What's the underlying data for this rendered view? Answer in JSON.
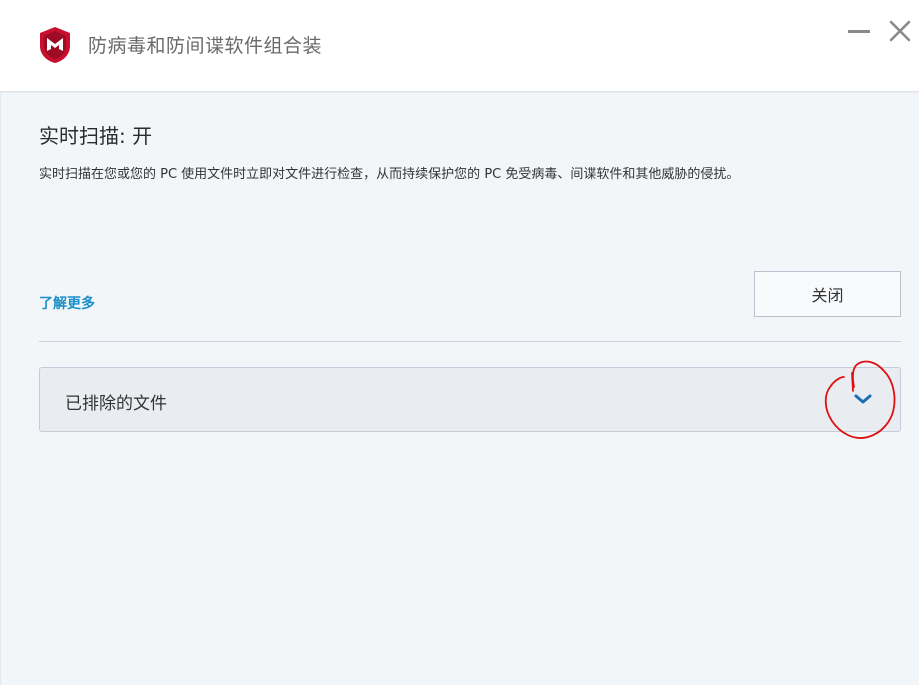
{
  "window": {
    "title": "防病毒和防间谍软件组合装",
    "logo_icon": "mcafee-shield-icon",
    "minimize_icon": "minimize-icon",
    "close_icon": "close-icon"
  },
  "panel": {
    "heading": "实时扫描: 开",
    "description": "实时扫描在您或您的 PC 使用文件时立即对文件进行检查，从而持续保护您的 PC 免受病毒、间谍软件和其他威胁的侵扰。",
    "learn_more": "了解更多",
    "toggle_button": "关闭"
  },
  "accordion": {
    "label": "已排除的文件",
    "expand_icon": "chevron-down-icon"
  },
  "colors": {
    "brand": "#c8102e",
    "link": "#1a8fc9",
    "chevron": "#1b6fb3",
    "annotation": "#e01010"
  }
}
